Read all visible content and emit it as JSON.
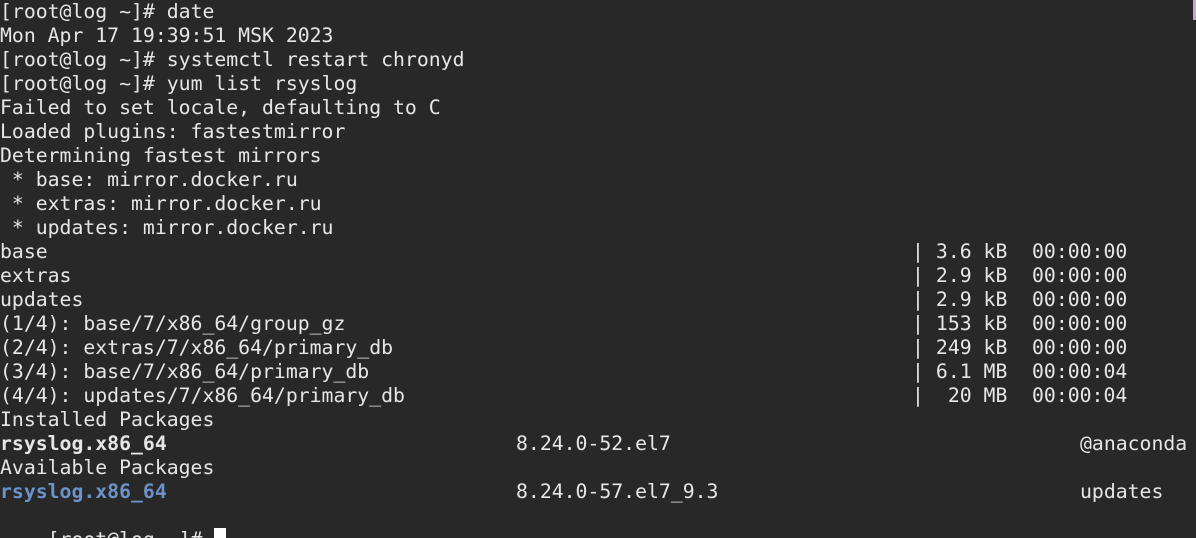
{
  "prompt": "[root@log ~]#",
  "session": [
    {
      "kind": "cmd",
      "command": "date"
    },
    {
      "kind": "out",
      "text": "Mon Apr 17 19:39:51 MSK 2023"
    },
    {
      "kind": "cmd",
      "command": "systemctl restart chronyd"
    },
    {
      "kind": "cmd",
      "command": "yum list rsyslog"
    },
    {
      "kind": "out",
      "text": "Failed to set locale, defaulting to C"
    },
    {
      "kind": "out",
      "text": "Loaded plugins: fastestmirror"
    },
    {
      "kind": "out",
      "text": "Determining fastest mirrors"
    },
    {
      "kind": "out",
      "text": " * base: mirror.docker.ru"
    },
    {
      "kind": "out",
      "text": " * extras: mirror.docker.ru"
    },
    {
      "kind": "out",
      "text": " * updates: mirror.docker.ru"
    }
  ],
  "downloads": [
    {
      "name": "base",
      "size": " 3.6 kB",
      "time": "00:00:00"
    },
    {
      "name": "extras",
      "size": " 2.9 kB",
      "time": "00:00:00"
    },
    {
      "name": "updates",
      "size": " 2.9 kB",
      "time": "00:00:00"
    },
    {
      "name": "(1/4): base/7/x86_64/group_gz",
      "size": " 153 kB",
      "time": "00:00:00"
    },
    {
      "name": "(2/4): extras/7/x86_64/primary_db",
      "size": " 249 kB",
      "time": "00:00:00"
    },
    {
      "name": "(3/4): base/7/x86_64/primary_db",
      "size": " 6.1 MB",
      "time": "00:00:04"
    },
    {
      "name": "(4/4): updates/7/x86_64/primary_db",
      "size": "  20 MB",
      "time": "00:00:04"
    }
  ],
  "separator": "|",
  "installed": {
    "heading": "Installed Packages",
    "package": "rsyslog.x86_64",
    "version": "8.24.0-52.el7",
    "repo": "@anaconda"
  },
  "available": {
    "heading": "Available Packages",
    "package": "rsyslog.x86_64",
    "version": "8.24.0-57.el7_9.3",
    "repo": "updates"
  },
  "colors": {
    "background": "#282828",
    "foreground": "#e6e6e6",
    "available_package": "#6b93c9",
    "cursor": "#ffffff",
    "scroll_marker": "#c7a7c9"
  }
}
